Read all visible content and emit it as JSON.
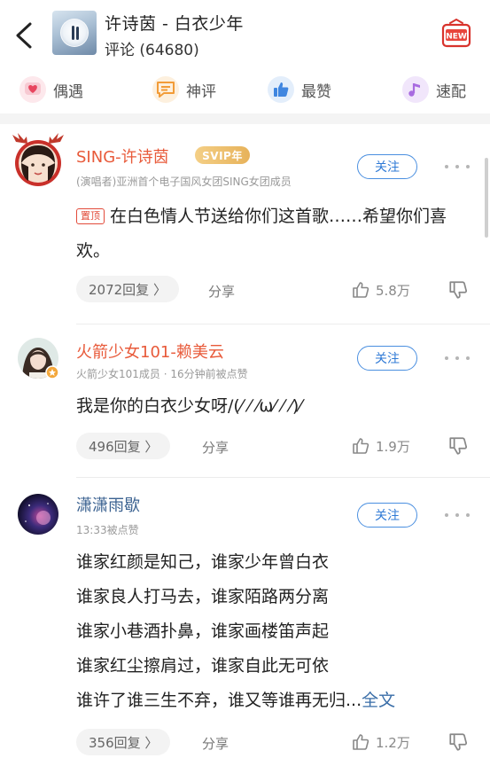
{
  "header": {
    "song_title": "许诗茵 - 白衣少年",
    "comment_count": "评论 (64680)",
    "new_label": "NEW"
  },
  "categories": [
    {
      "label": "偶遇",
      "icon": "heart-chat-icon",
      "color": "#e8455f"
    },
    {
      "label": "神评",
      "icon": "message-icon",
      "color": "#f29c38"
    },
    {
      "label": "最赞",
      "icon": "thumbs-up-icon",
      "color": "#3f86e0"
    },
    {
      "label": "速配",
      "icon": "music-note-icon",
      "color": "#a86be0"
    }
  ],
  "comments": [
    {
      "username": "SING-许诗茵",
      "badge": "SVIP年",
      "subtitle": "(演唱者)亚洲首个电子国风女团SING女团成员",
      "follow_label": "关注",
      "pin_label": "置顶",
      "text": "在白色情人节送给你们这首歌……希望你们喜欢。",
      "reply_label": "2072回复 〉",
      "share_label": "分享",
      "likes": "5.8万"
    },
    {
      "username": "火箭少女101-赖美云",
      "subtitle": "火箭少女101成员 · 16分钟前被点赞",
      "follow_label": "关注",
      "text": "我是你的白衣少女呀/(⁄ ⁄ ⁄ω⁄ ⁄ ⁄)⁄",
      "reply_label": "496回复 〉",
      "share_label": "分享",
      "likes": "1.9万"
    },
    {
      "username": "潇潇雨歇",
      "subtitle": "13:33被点赞",
      "follow_label": "关注",
      "lines": [
        "谁家红颜是知己，谁家少年曾白衣",
        "谁家良人打马去，谁家陌路两分离",
        "谁家小巷酒扑鼻，谁家画楼笛声起",
        "谁家红尘擦肩过，谁家自此无可依",
        "谁许了谁三生不弃，谁又等谁再无归..."
      ],
      "full_text_label": "全文",
      "reply_label": "356回复 〉",
      "share_label": "分享",
      "likes": "1.2万"
    }
  ],
  "colors": {
    "accent_blue": "#2f7ad6",
    "name_red": "#e85a3a",
    "name_blue": "#3a6190"
  }
}
